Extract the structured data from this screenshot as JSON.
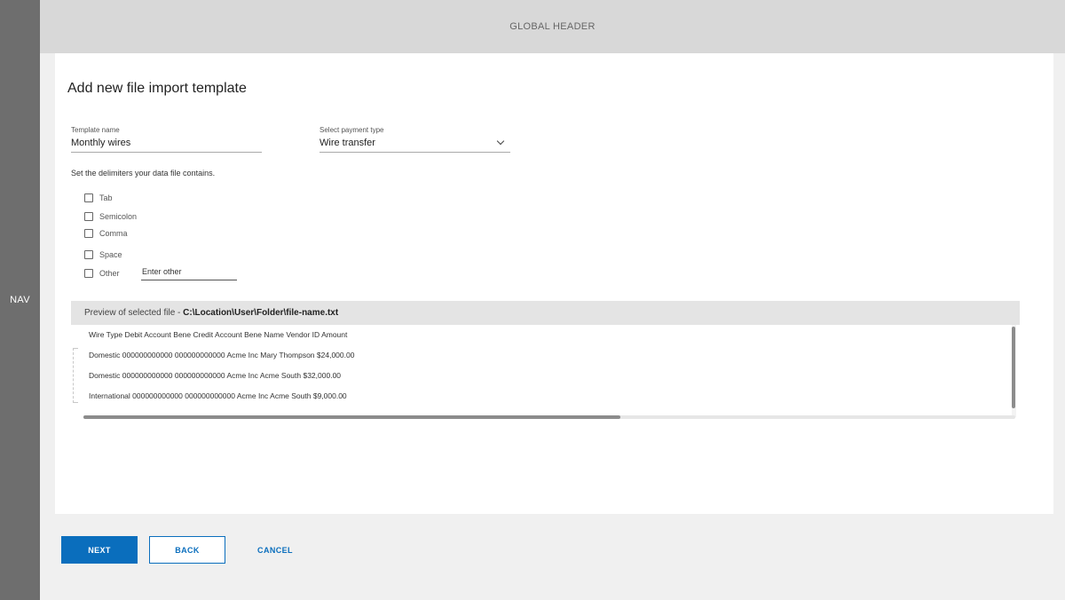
{
  "nav": {
    "label": "NAV"
  },
  "header": {
    "title": "GLOBAL HEADER"
  },
  "page": {
    "title": "Add new file import template"
  },
  "form": {
    "template_name": {
      "label": "Template name",
      "value": "Monthly wires"
    },
    "payment_type": {
      "label": "Select payment type",
      "value": "Wire transfer"
    },
    "delimiters_instructions": "Set the delimiters your data file contains.",
    "delimiters": [
      {
        "label": "Tab",
        "checked": false
      },
      {
        "label": "Semicolon",
        "checked": false
      },
      {
        "label": "Comma",
        "checked": false
      },
      {
        "label": "Space",
        "checked": false
      },
      {
        "label": "Other",
        "checked": false
      }
    ],
    "other_placeholder": "Enter other"
  },
  "preview": {
    "title_prefix": "Preview of selected file - ",
    "file_path": "C:\\Location\\User\\Folder\\file-name.txt",
    "rows": [
      "Wire Type  Debit Account  Bene Credit Account  Bene Name  Vendor ID  Amount",
      "Domestic  000000000000  000000000000  Acme Inc  Mary Thompson  $24,000.00",
      "Domestic  000000000000  000000000000  Acme Inc  Acme South  $32,000.00",
      "International  000000000000  000000000000  Acme Inc  Acme South  $9,000.00"
    ]
  },
  "actions": {
    "next": "NEXT",
    "back": "BACK",
    "cancel": "CANCEL"
  },
  "colors": {
    "primary": "#0a6ebd",
    "nav_bg": "#6e6e6e",
    "header_bg": "#d8d8d8",
    "page_bg": "#f0f0f0"
  },
  "icons": {
    "dropdown": "chevron-down-icon",
    "checkbox": "checkbox-unchecked-icon"
  }
}
